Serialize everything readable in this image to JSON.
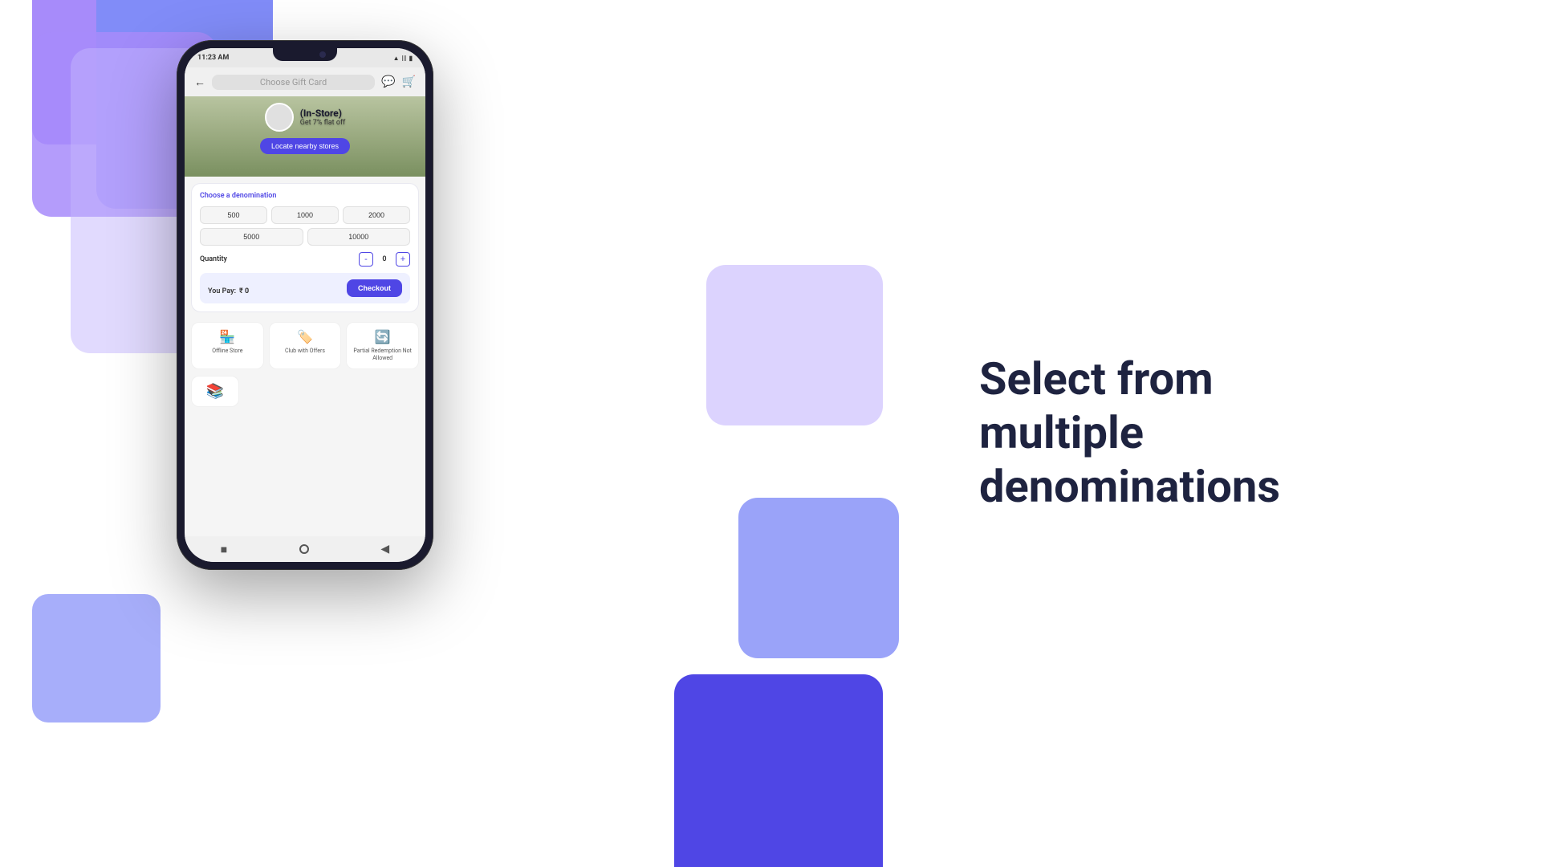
{
  "background": {
    "shapes": "decorative"
  },
  "phone": {
    "status_bar": {
      "time": "11:23 AM",
      "battery": "🔋",
      "wifi": "WiFi",
      "signal": "📶"
    },
    "header": {
      "back_icon": "←",
      "title": "Choose Gift Card",
      "whatsapp_icon": "💬",
      "cart_icon": "🛒"
    },
    "hero": {
      "store_name": "(In-Store)",
      "store_offer": "Get 7% flat off",
      "locate_button": "Locate nearby stores"
    },
    "denomination": {
      "title": "Choose a denomination",
      "options": [
        "500",
        "1000",
        "2000",
        "5000",
        "10000"
      ],
      "quantity_label": "Quantity",
      "quantity_value": "0",
      "qty_minus": "-",
      "qty_plus": "+",
      "you_pay_label": "You Pay:",
      "you_pay_amount": "₹ 0",
      "checkout_button": "Checkout"
    },
    "features": [
      {
        "icon": "🏪",
        "label": "Offline Store"
      },
      {
        "icon": "🏷️",
        "label": "Club with Offers"
      },
      {
        "icon": "🔄",
        "label": "Partial Redemption Not Allowed"
      }
    ],
    "bottom_scroll": {
      "icon": "📚"
    },
    "nav": {
      "square": "■",
      "circle": "●",
      "back": "◀"
    }
  },
  "right_section": {
    "heading_line1": "Select from multiple",
    "heading_line2": "denominations"
  }
}
